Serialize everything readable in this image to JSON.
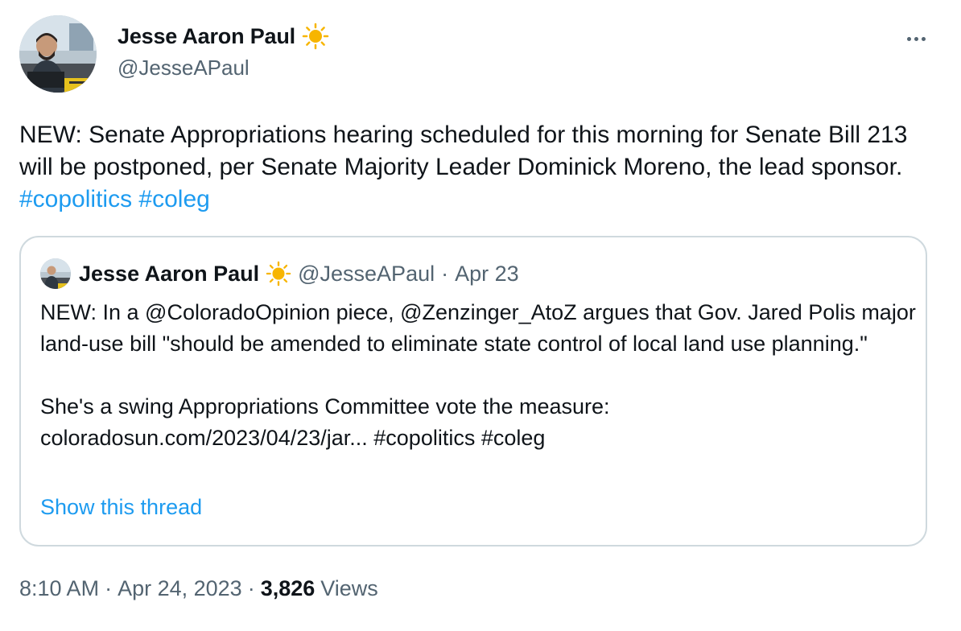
{
  "tweet": {
    "author_name": "Jesse Aaron Paul",
    "author_emoji": "sun-icon",
    "author_handle": "@JesseAPaul",
    "text_main": "NEW: Senate Appropriations hearing scheduled for this morning for Senate Bill 213 will be postponed, per Senate Majority Leader Dominick Moreno, the lead sponsor.",
    "hashtags": [
      "#copolitics",
      "#coleg"
    ],
    "time": "8:10 AM",
    "date": "Apr 24, 2023",
    "views_count": "3,826",
    "views_label": "Views",
    "separator": "·"
  },
  "quote": {
    "author_name": "Jesse Aaron Paul",
    "author_handle": "@JesseAPaul",
    "separator": "·",
    "date": "Apr 23",
    "para1": "NEW: In a @ColoradoOpinion piece, @Zenzinger_AtoZ argues that Gov. Jared Polis major land-use bill \"should be amended to eliminate state control of local land use planning.\"",
    "para2_line1": "She's a swing Appropriations Committee vote the measure:",
    "para2_line2": "coloradosun.com/2023/04/23/jar... #copolitics #coleg",
    "show_thread": "Show this thread"
  },
  "colors": {
    "link": "#1d9bf0",
    "secondary_text": "#536471",
    "border": "#cfd9de",
    "sun": "#f7b500"
  }
}
